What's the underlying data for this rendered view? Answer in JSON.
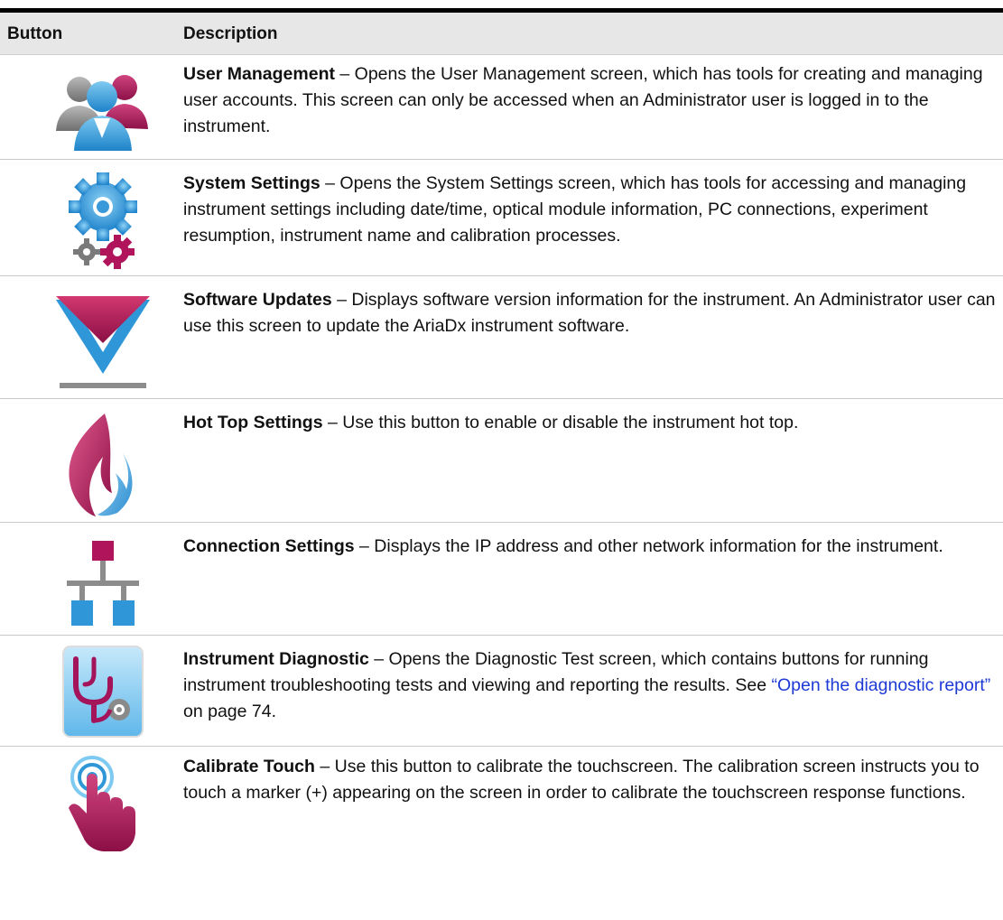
{
  "table": {
    "headers": {
      "button": "Button",
      "description": "Description"
    },
    "rows": [
      {
        "icon": "user-management-icon",
        "title": "User Management",
        "separator": " – ",
        "text": "Opens the User Management screen, which has tools for creating and managing user accounts. This screen can only be accessed when an Administrator user is logged in to the instrument."
      },
      {
        "icon": "system-settings-icon",
        "title": "System Settings",
        "separator": " – ",
        "text": "Opens the System Settings screen, which has tools for accessing and managing instrument settings including date/time, optical module information, PC connections, experiment resumption, instrument name and calibration processes."
      },
      {
        "icon": "software-updates-icon",
        "title": "Software Updates",
        "separator": " – ",
        "text": "Displays software version information for the instrument. An Administrator user can use this screen to update the AriaDx instrument software."
      },
      {
        "icon": "hot-top-icon",
        "title": "Hot Top Settings",
        "separator": " – ",
        "text": "Use this button to enable or disable the instrument hot top."
      },
      {
        "icon": "connection-settings-icon",
        "title": "Connection Settings",
        "separator": " – ",
        "text": "Displays the IP address and other network information for the instrument."
      },
      {
        "icon": "instrument-diagnostic-icon",
        "title": "Instrument Diagnostic",
        "separator": " – ",
        "text": "Opens the Diagnostic Test screen, which contains buttons for running instrument troubleshooting tests and viewing and reporting the results. See ",
        "link": "“Open the diagnostic report”",
        "after_link": " on page 74."
      },
      {
        "icon": "calibrate-touch-icon",
        "title": "Calibrate Touch",
        "separator": " – ",
        "text": "Use this button to calibrate the touchscreen. The calibration screen instructs you to touch a marker (+) appearing on the screen in order to calibrate the touchscreen response functions."
      }
    ]
  },
  "colors": {
    "accent_magenta": "#a3145a",
    "accent_blue": "#2f96d8",
    "link": "#1d39d6"
  }
}
